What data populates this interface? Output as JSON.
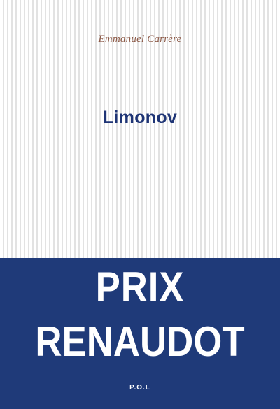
{
  "cover": {
    "author": "Emmanuel Carrère",
    "title": "Limonov",
    "prize_line_1": "PRIX",
    "prize_line_2": "RENAUDOT",
    "publisher": "P.O.L"
  },
  "colors": {
    "title": "#1f3576",
    "author": "#8c5a48",
    "band": "#1f3a79",
    "prize_text": "#ffffff",
    "stripes": "#e2e2e2"
  }
}
